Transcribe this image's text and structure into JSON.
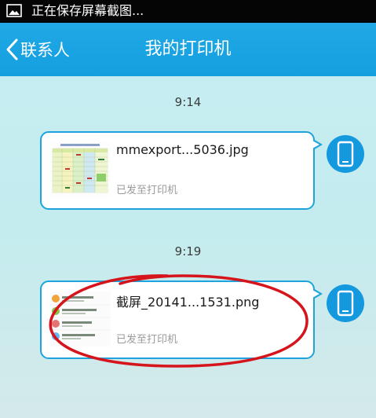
{
  "status_bar": {
    "notification_text": "正在保存屏幕截图..."
  },
  "header": {
    "back_label": "联系人",
    "title": "我的打印机"
  },
  "messages": [
    {
      "time": "9:14",
      "filename": "mmexport...5036.jpg",
      "status": "已发至打印机"
    },
    {
      "time": "9:19",
      "filename": "截屏_20141...1531.png",
      "status": "已发至打印机"
    }
  ],
  "colors": {
    "title_bar": "#1aa3e2",
    "bubble_border": "#1ea3dc",
    "avatar": "#1599de",
    "annotation": "#d6141b",
    "background": "#c7eef2"
  },
  "icons": {
    "status_bar": "image-icon",
    "back": "chevron-left-icon",
    "avatar": "phone-icon"
  }
}
